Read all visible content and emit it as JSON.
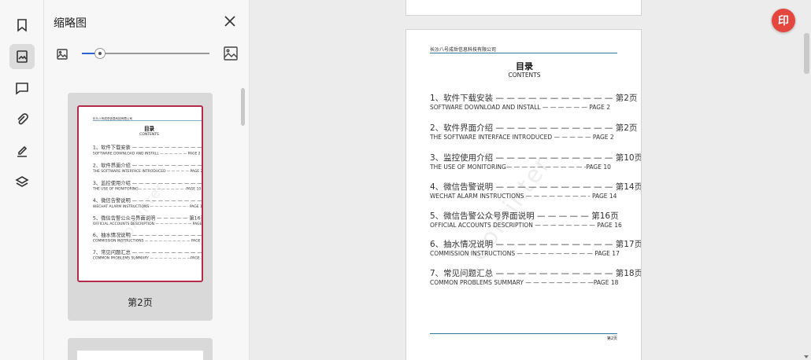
{
  "sidebar": {
    "icons": [
      {
        "name": "bookmark-icon",
        "active": false
      },
      {
        "name": "thumbnail-icon",
        "active": true
      },
      {
        "name": "comment-icon",
        "active": false
      },
      {
        "name": "attachment-icon",
        "active": false
      },
      {
        "name": "signature-icon",
        "active": false
      },
      {
        "name": "layers-icon",
        "active": false
      }
    ]
  },
  "panel": {
    "title": "缩略图",
    "zoom_level": 0.14,
    "thumb_label": "第2页"
  },
  "document": {
    "company": "长沙八号成岳信息科技有限公司",
    "title": "目录",
    "subtitle": "CONTENTS",
    "watermark": "Cominter",
    "footer": "第2页",
    "entries": [
      {
        "cn": "1、软件下载安装 — — — — — — — — — — — 第2页",
        "en": "SOFTWARE DOWNLOAD AND INSTALL  — — — — — —  PAGE 2"
      },
      {
        "cn": "2、软件界面介绍 — — — — — — — — — — — 第2页",
        "en": "THE SOFTWARE INTERFACE INTRODUCED — — — — —  PAGE 2"
      },
      {
        "cn": "3、监控使用介绍 — — — — — — — — — — — 第10页",
        "en": "THE USE OF  MONITORING— — — — — — — — — — -PAGE 10"
      },
      {
        "cn": "4、微信告警说明 — — — — — — — — — — — 第14页",
        "en": "WECHAT ALARM INSTRUCTIONS — — — — — — — — -  PAGE 14"
      },
      {
        "cn": "5、微信告警公众号界面说明 — — — — — 第16页",
        "en": "OFFICIAL ACCOUNTS DESCRIPTION — — — — — — — —  PAGE 16"
      },
      {
        "cn": "6、抽水情况说明 — — — — — — — — — — — 第17页",
        "en": "COMMISSION  INSTRUCTIONS  — — — — — — — — — —  PAGE 17"
      },
      {
        "cn": "7、常见问题汇总 — — — — — — — — — — — 第18页",
        "en": "COMMON PROBLEMS SUMMARY — — — — — — — — —PAGE 18"
      }
    ]
  },
  "fab": {
    "label": "印",
    "color": "#e5473e"
  },
  "colors": {
    "accent": "#2b63d8",
    "thumb_border": "#b52a4b",
    "rule": "#2d7898"
  }
}
